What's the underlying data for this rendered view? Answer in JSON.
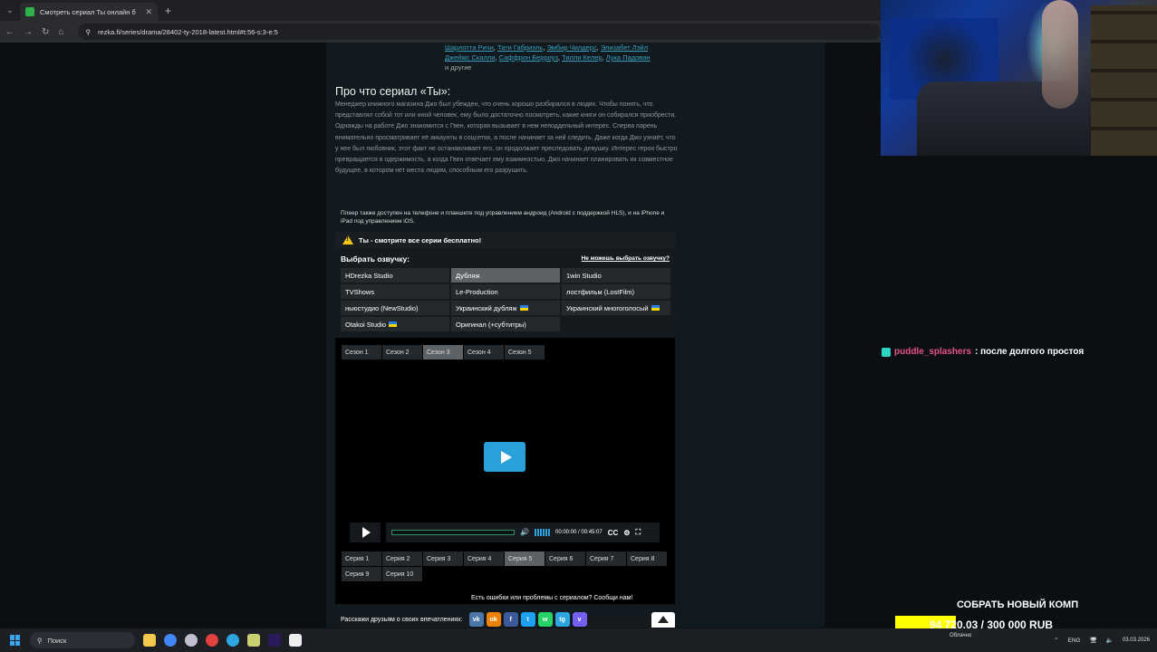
{
  "browser": {
    "tab_title": "Смотреть сериал Ты онлайн б",
    "url": "rezka.fi/series/drama/28402-ty-2018-latest.html#t:56-s:3-e:5"
  },
  "cast": {
    "line1": [
      "Шарлотта Ричи",
      "Тати Габриэль",
      "Эмбир Чилдерс",
      "Элизабет Лэйл"
    ],
    "line2": [
      "Джеймс Скалли",
      "Саффрон Берроуз",
      "Тилли Келер",
      "Лука Падован"
    ],
    "rest": "и другие"
  },
  "about": {
    "title": "Про что сериал «Ты»:",
    "p1": "Менеджер книжного магазина Джо был убежден, что очень хорошо разбирался в людях. Чтобы понять, что представлял собой тот или иной человек, ему было достаточно посмотреть, какие книги он собирался приобрести.",
    "p2": "Однажды на работе Джо знакомится с Гвен, которая вызывает в нем неподдельный интерес. Сперва парень внимательно просматривает её аккаунты в соцсетях, а после начинает за ней следить. Даже когда Джо узнаёт, что у нее был любовник, этот факт не останавливает его, он продолжает преследовать девушку. Интерес героя быстро превращается в одержимость, а когда Гвен отвечает ему взаимностью, Джо начинает планировать их совместное будущее, в котором нет места людям, способным его разрушить."
  },
  "player_note": "Плеер также доступен на телефоне и планшете под управлением андроид (Android с поддержкой HLS), и на iPhone и iPad под управлением iOS.",
  "free_notice": "Ты - смотрите все серии бесплатно!",
  "dubbing": {
    "title": "Выбрать озвучку:",
    "help_link": "Не можешь выбрать озвучку?",
    "options": [
      {
        "label": "HDrezka Studio",
        "active": false,
        "flag": false
      },
      {
        "label": "Дубляж",
        "active": true,
        "flag": false
      },
      {
        "label": "1win Studio",
        "active": false,
        "flag": false
      },
      {
        "label": "TVShows",
        "active": false,
        "flag": false
      },
      {
        "label": "Le-Production",
        "active": false,
        "flag": false
      },
      {
        "label": "лостфильм (LostFilm)",
        "active": false,
        "flag": false
      },
      {
        "label": "ньюстудио (NewStudio)",
        "active": false,
        "flag": false
      },
      {
        "label": "Украинский дубляж",
        "active": false,
        "flag": true
      },
      {
        "label": "Украинский многоголосый",
        "active": false,
        "flag": true
      },
      {
        "label": "Otakoi Studio",
        "active": false,
        "flag": true
      },
      {
        "label": "Оригинал (+субтитры)",
        "active": false,
        "flag": false
      }
    ]
  },
  "seasons": [
    "Сезон 1",
    "Сезон 2",
    "Сезон 3",
    "Сезон 4",
    "Сезон 5"
  ],
  "active_season": 2,
  "episodes": [
    "Серия 1",
    "Серия 2",
    "Серия 3",
    "Серия 4",
    "Серия 5",
    "Серия 6",
    "Серия 7",
    "Серия 8",
    "Серия 9",
    "Серия 10"
  ],
  "active_episode": 4,
  "player": {
    "time": "00:00:00 / 00:45:07",
    "progress": 0
  },
  "report_text": "Есть ошибки или проблемы с сериалом? Сообщи нам!",
  "share": {
    "label": "Расскажи друзьям о своих впечатлениях:",
    "networks": [
      {
        "icon": "vk-icon",
        "text": "vk",
        "color": "#4a76a8"
      },
      {
        "icon": "ok-icon",
        "text": "ok",
        "color": "#ee8208"
      },
      {
        "icon": "facebook-icon",
        "text": "f",
        "color": "#3b5998"
      },
      {
        "icon": "twitter-icon",
        "text": "t",
        "color": "#1da1f2"
      },
      {
        "icon": "whatsapp-icon",
        "text": "w",
        "color": "#25d366"
      },
      {
        "icon": "telegram-icon",
        "text": "tg",
        "color": "#2ca5e0"
      },
      {
        "icon": "viber-icon",
        "text": "v",
        "color": "#7360f2"
      }
    ]
  },
  "stream": {
    "chat_user": "puddle_splashers",
    "chat_text": ": после долгого простоя",
    "goal_title": "СОБРАТЬ НОВЫЙ КОМП",
    "goal_text": "94 720.03 / 300 000 RUB",
    "goal_progress": 0.3157
  },
  "taskbar": {
    "search_placeholder": "Поиск",
    "weather": "Облачно",
    "lang": "ENG",
    "date": "03.03.2026"
  },
  "colors": {
    "accent": "#2aa0d8",
    "link": "#3aa0c0",
    "goal": "#ffff00"
  }
}
